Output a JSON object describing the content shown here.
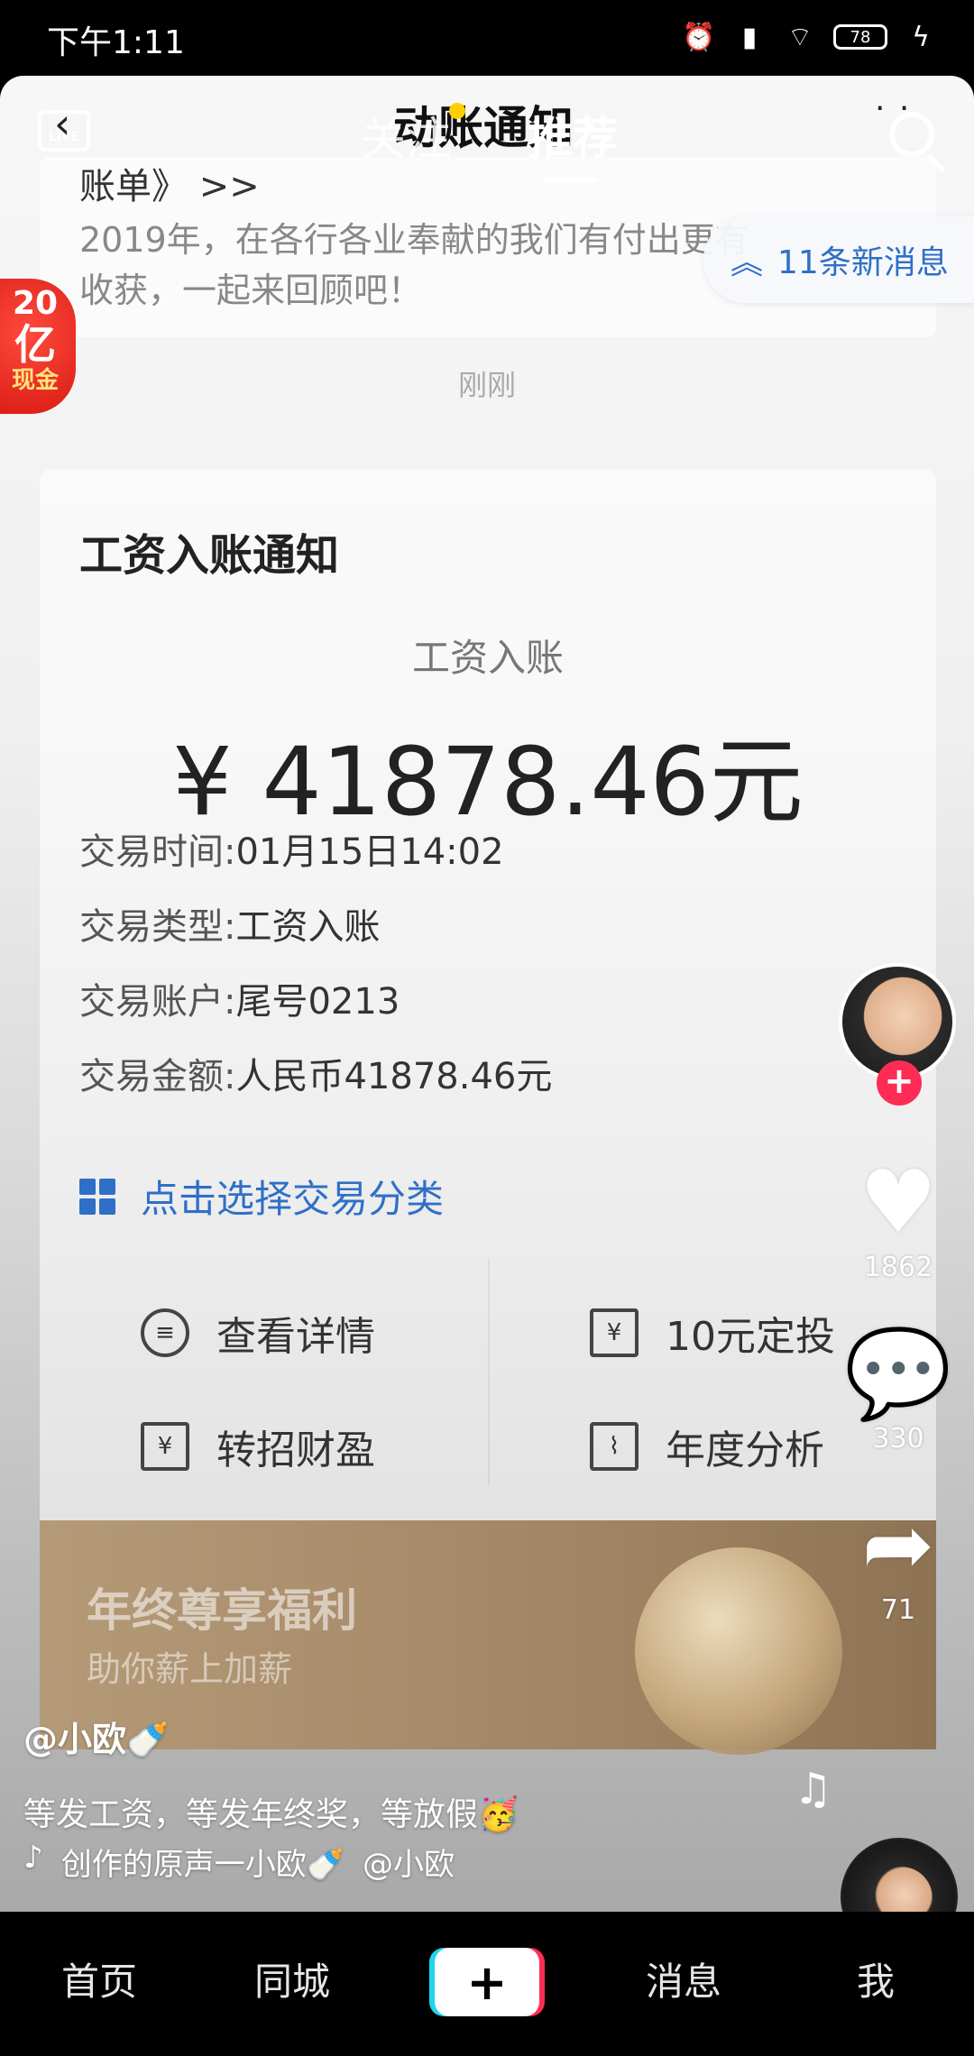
{
  "statusbar": {
    "time": "下午1:11",
    "battery": "78",
    "icons": [
      "alarm-icon",
      "signal-icon",
      "wifi-icon",
      "battery-icon",
      "charging-icon"
    ]
  },
  "topnav": {
    "video_title": "动账通知",
    "tabs": [
      {
        "label": "关注",
        "active": false
      },
      {
        "label": "推荐",
        "active": true
      }
    ],
    "more": "· ·"
  },
  "new_messages": "11条新消息",
  "prev_message": {
    "head": "账单》 >>",
    "body": "2019年，在各行各业奉献的我们有付出更有收获，一起来回顾吧！"
  },
  "time_sep": "刚刚",
  "promo_badge": {
    "line1": "20",
    "line2": "亿",
    "line3": "现金"
  },
  "notice": {
    "title": "工资入账通知",
    "amount_label": "工资入账",
    "amount": "¥ 41878.46元",
    "details": [
      {
        "key": "交易时间:",
        "value": "01月15日14:02"
      },
      {
        "key": "交易类型:",
        "value": "工资入账"
      },
      {
        "key": "交易账户:",
        "value": "尾号0213"
      },
      {
        "key": "交易金额:",
        "value": "人民币41878.46元"
      }
    ],
    "category_link": "点击选择交易分类",
    "actions": [
      {
        "label": "查看详情",
        "icon": "list-icon"
      },
      {
        "label": "10元定投",
        "icon": "scroll-icon"
      },
      {
        "label": "转招财盈",
        "icon": "transfer-icon"
      },
      {
        "label": "年度分析",
        "icon": "chart-icon"
      }
    ]
  },
  "banner": {
    "title": "年终尊享福利",
    "subtitle": "助你薪上加薪"
  },
  "rail": {
    "likes": "1862",
    "comments": "330",
    "shares": "71"
  },
  "caption": {
    "user": "@小欧🍼",
    "text": "等发工资，等发年终奖，等放假🥳"
  },
  "music": {
    "track": "创作的原声一小欧🍼",
    "author": "@小欧"
  },
  "bottom_nav": {
    "home": "首页",
    "city": "同城",
    "add": "+",
    "messages": "消息",
    "me": "我"
  }
}
